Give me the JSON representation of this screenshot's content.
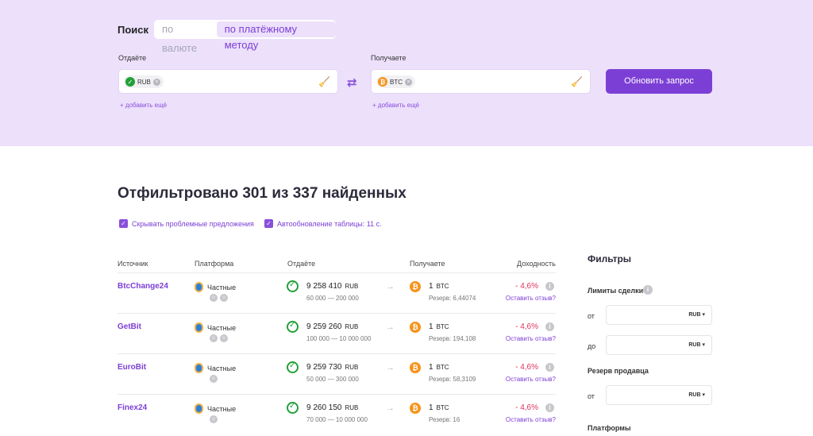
{
  "search": {
    "label": "Поиск",
    "tabs": [
      "по валюте",
      "по платёжному методу"
    ],
    "give_label": "Отдаёте",
    "get_label": "Получаете",
    "give_chip": "RUB",
    "get_chip": "BTC",
    "add_more": "+ добавить ещё",
    "refresh_button": "Обновить запрос"
  },
  "results": {
    "headline": "Отфильтровано 301 из 337 найденных",
    "hide_problem": "Скрывать проблемные предложения",
    "autorefresh": "Автообновление таблицы: 11 с."
  },
  "table": {
    "headers": [
      "Источник",
      "Платформа",
      "Отдаёте",
      "Получаете",
      "Доходность"
    ],
    "rows": [
      {
        "source": "BtcChange24",
        "platform": "Частные",
        "give": "9 258 410",
        "give_cur": "RUB",
        "limits": "60 000 — 200 000",
        "get": "1",
        "get_cur": "BTC",
        "reserve": "Резерв: 6,44074",
        "yield": "- 4,6%",
        "review": "Оставить отзыв?"
      },
      {
        "source": "GetBit",
        "platform": "Частные",
        "give": "9 259 260",
        "give_cur": "RUB",
        "limits": "100 000 — 10 000 000",
        "get": "1",
        "get_cur": "BTC",
        "reserve": "Резерв: 194,108",
        "yield": "- 4,6%",
        "review": "Оставить отзыв?"
      },
      {
        "source": "EuroBit",
        "platform": "Частные",
        "give": "9 259 730",
        "give_cur": "RUB",
        "limits": "50 000 — 300 000",
        "get": "1",
        "get_cur": "BTC",
        "reserve": "Резерв: 58,3109",
        "yield": "- 4,6%",
        "review": "Оставить отзыв?"
      },
      {
        "source": "Finex24",
        "platform": "Частные",
        "give": "9 260 150",
        "give_cur": "RUB",
        "limits": "70 000 — 10 000 000",
        "get": "1",
        "get_cur": "BTC",
        "reserve": "Резерв: 16",
        "yield": "- 4,6%",
        "review": "Оставить отзыв?"
      }
    ]
  },
  "filters": {
    "title": "Фильтры",
    "deal_limits": "Лимиты сделки",
    "from": "от",
    "to": "до",
    "unit": "RUB",
    "seller_reserve": "Резерв продавца",
    "platforms": "Платформы"
  },
  "colors": {
    "accent": "#7c3fd5",
    "top_bg": "#ece0fb",
    "negative": "#e0325c",
    "btc": "#f7931a",
    "sber": "#21a038"
  }
}
